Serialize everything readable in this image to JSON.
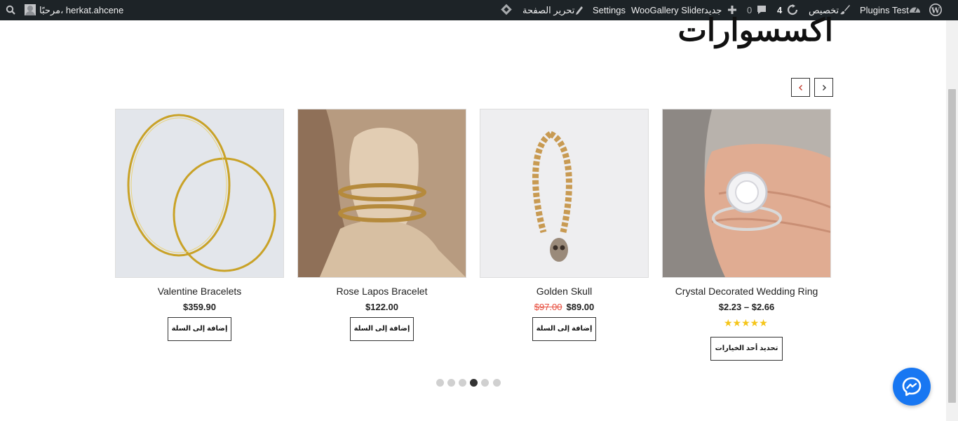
{
  "adminbar": {
    "greeting": "مرحبًا، herkat.ahcene",
    "site_name": "Plugins Test",
    "customize": "تخصيص",
    "updates_count": "4",
    "comments_count": "0",
    "new_label": "جديد",
    "woogallery": "WooGallery Slider",
    "settings": "Settings",
    "edit_page": "تحرير الصفحة"
  },
  "page": {
    "title": "اكسسوارات"
  },
  "products": [
    {
      "name": "Valentine Bracelets",
      "price": "$359.90",
      "button": "إضافة إلى السلة"
    },
    {
      "name": "Rose Lapos Bracelet",
      "price": "$122.00",
      "button": "إضافة إلى السلة"
    },
    {
      "name": "Golden Skull",
      "old_price": "$97.00",
      "price": "$89.00",
      "button": "إضافة إلى السلة"
    },
    {
      "name": "Crystal Decorated Wedding Ring",
      "price": "$2.23 – $2.66",
      "rating": 5,
      "stars": "★★★★★",
      "button": "تحديد أحد الخيارات"
    }
  ],
  "slider": {
    "dot_count": 6,
    "active_dot": 4
  },
  "colors": {
    "adminbar_bg": "#1d2327",
    "sale_price": "#e74c3c",
    "stars": "#f5c518",
    "messenger": "#1877f2"
  }
}
